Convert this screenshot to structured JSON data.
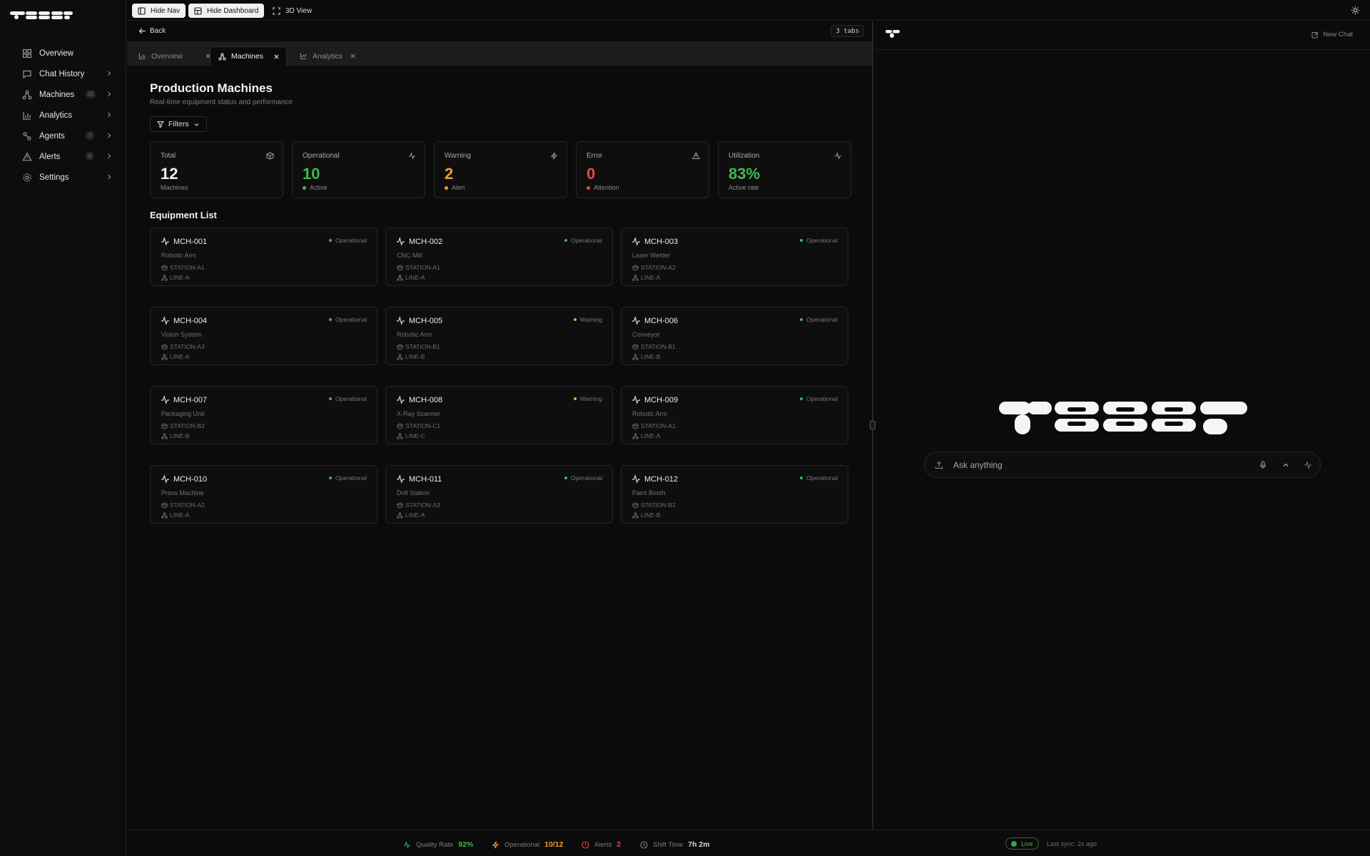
{
  "colors": {
    "green": "#3fb950",
    "orange": "#f0a030",
    "red": "#e5484d",
    "white": "#f2f2f2"
  },
  "topbar": {
    "hide_nav": "Hide Nav",
    "hide_dashboard": "Hide Dashboard",
    "view_3d": "3D View"
  },
  "sidebar": {
    "items": [
      {
        "label": "Overview",
        "icon": "grid-icon"
      },
      {
        "label": "Chat History",
        "icon": "chat-icon"
      },
      {
        "label": "Machines",
        "icon": "network-icon",
        "badge": "12"
      },
      {
        "label": "Analytics",
        "icon": "bar-chart-icon"
      },
      {
        "label": "Agents",
        "icon": "agents-icon",
        "badge": "7"
      },
      {
        "label": "Alerts",
        "icon": "alert-triangle-icon",
        "badge": "0"
      },
      {
        "label": "Settings",
        "icon": "gear-icon"
      }
    ]
  },
  "main": {
    "back": "Back",
    "tabs_count": "3 tabs",
    "tabs": [
      {
        "label": "Overview",
        "icon": "bar-chart-icon"
      },
      {
        "label": "Machines",
        "icon": "network-icon"
      },
      {
        "label": "Analytics",
        "icon": "line-chart-icon"
      }
    ],
    "title": "Production Machines",
    "subtitle": "Real-time equipment status and performance",
    "filters": "Filters",
    "stats": [
      {
        "label": "Total",
        "value": "12",
        "sub": "Machines",
        "icon": "box-icon",
        "color": "#f2f2f2",
        "dot": ""
      },
      {
        "label": "Operational",
        "value": "10",
        "sub": "Active",
        "icon": "activity-icon",
        "color": "#3fb950",
        "dot": "#3fb950"
      },
      {
        "label": "Warning",
        "value": "2",
        "sub": "Alert",
        "icon": "zap-icon",
        "color": "#f0a030",
        "dot": "#f0a030"
      },
      {
        "label": "Error",
        "value": "0",
        "sub": "Attention",
        "icon": "alert-triangle-icon",
        "color": "#e5484d",
        "dot": "#e5484d"
      },
      {
        "label": "Utilization",
        "value": "83%",
        "sub": "Active rate",
        "icon": "activity-icon",
        "color": "#3fb950",
        "dot": ""
      }
    ],
    "section_title": "Equipment List",
    "machines": [
      {
        "id": "MCH-001",
        "type": "Robotic Arm",
        "station": "STATION-A1",
        "line": "LINE-A",
        "status": "Operational"
      },
      {
        "id": "MCH-002",
        "type": "CNC Mill",
        "station": "STATION-A1",
        "line": "LINE-A",
        "status": "Operational"
      },
      {
        "id": "MCH-003",
        "type": "Laser Welder",
        "station": "STATION-A2",
        "line": "LINE-A",
        "status": "Operational"
      },
      {
        "id": "MCH-004",
        "type": "Vision System",
        "station": "STATION-A3",
        "line": "LINE-A",
        "status": "Operational"
      },
      {
        "id": "MCH-005",
        "type": "Robotic Arm",
        "station": "STATION-B1",
        "line": "LINE-B",
        "status": "Warning"
      },
      {
        "id": "MCH-006",
        "type": "Conveyor",
        "station": "STATION-B1",
        "line": "LINE-B",
        "status": "Operational"
      },
      {
        "id": "MCH-007",
        "type": "Packaging Unit",
        "station": "STATION-B2",
        "line": "LINE-B",
        "status": "Operational"
      },
      {
        "id": "MCH-008",
        "type": "X-Ray Scanner",
        "station": "STATION-C1",
        "line": "LINE-C",
        "status": "Warning"
      },
      {
        "id": "MCH-009",
        "type": "Robotic Arm",
        "station": "STATION-A1",
        "line": "LINE-A",
        "status": "Operational"
      },
      {
        "id": "MCH-010",
        "type": "Press Machine",
        "station": "STATION-A2",
        "line": "LINE-A",
        "status": "Operational"
      },
      {
        "id": "MCH-011",
        "type": "Drill Station",
        "station": "STATION-A3",
        "line": "LINE-A",
        "status": "Operational"
      },
      {
        "id": "MCH-012",
        "type": "Paint Booth",
        "station": "STATION-B2",
        "line": "LINE-B",
        "status": "Operational"
      }
    ]
  },
  "chat": {
    "new_chat": "New Chat",
    "placeholder": "Ask anything"
  },
  "footer": {
    "quality_label": "Quality Rate",
    "quality_value": "92%",
    "operational_label": "Operational",
    "operational_value": "10/12",
    "alerts_label": "Alerts",
    "alerts_value": "2",
    "shift_label": "Shift Time",
    "shift_value": "7h 2m",
    "live": "Live",
    "sync": "Last sync: 2s ago"
  }
}
